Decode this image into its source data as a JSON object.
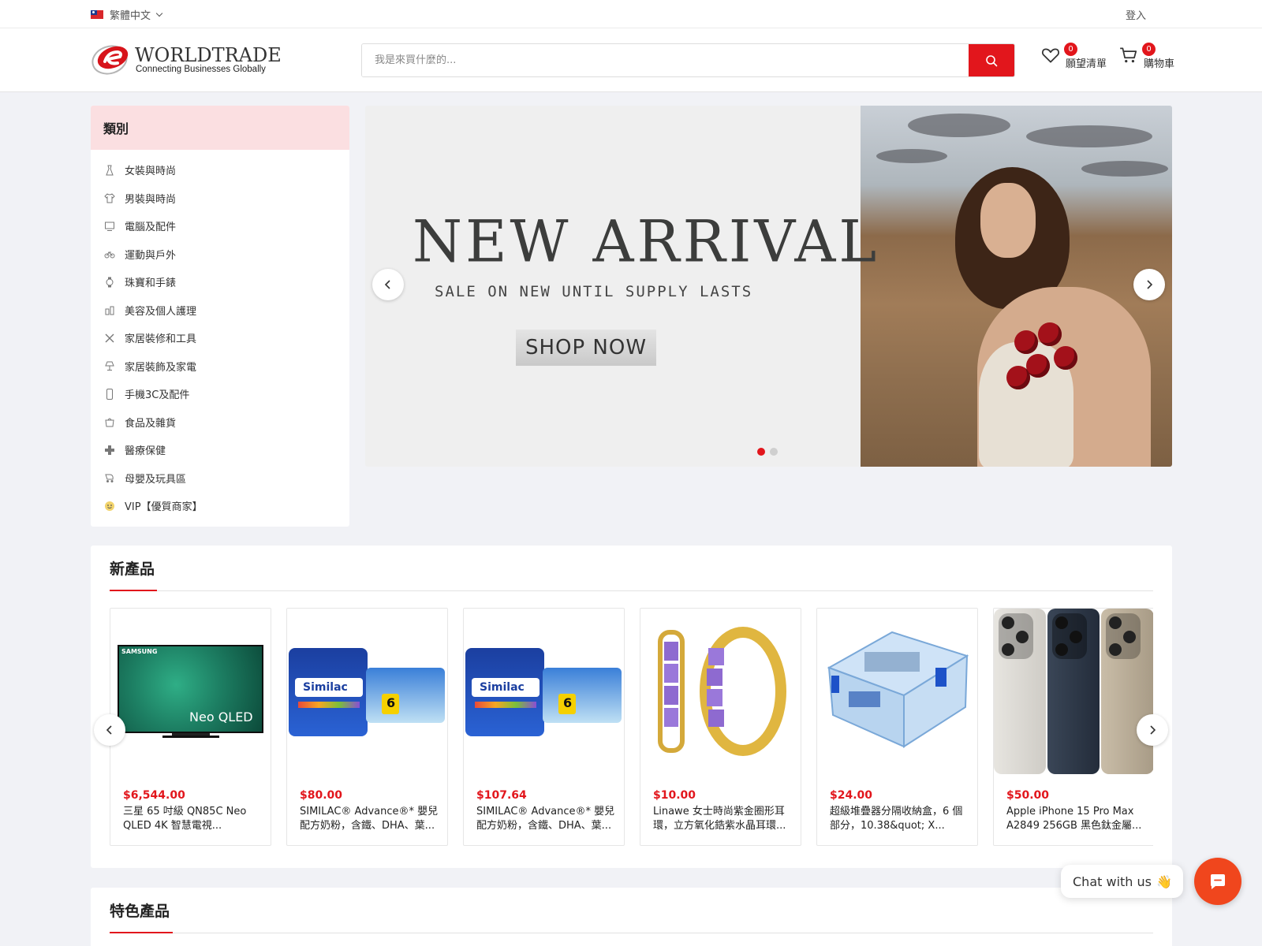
{
  "topbar": {
    "language": "繁體中文",
    "login": "登入"
  },
  "header": {
    "logo_word": "WORLDTRADE",
    "logo_tagline": "Connecting Businesses Globally",
    "search_placeholder": "我是來買什麼的...",
    "wishlist_count": "0",
    "wishlist_label": "願望清單",
    "cart_count": "0",
    "cart_label": "購物車"
  },
  "categories": {
    "title": "類別",
    "items": [
      {
        "label": "女裝與時尚",
        "icon": "dress-icon"
      },
      {
        "label": "男裝與時尚",
        "icon": "shirt-icon"
      },
      {
        "label": "電腦及配件",
        "icon": "computer-icon"
      },
      {
        "label": "運動與戶外",
        "icon": "bike-icon"
      },
      {
        "label": "珠寶和手錶",
        "icon": "watch-icon"
      },
      {
        "label": "美容及個人護理",
        "icon": "beauty-icon"
      },
      {
        "label": "家居裝修和工具",
        "icon": "tools-icon"
      },
      {
        "label": "家居裝飾及家電",
        "icon": "lamp-icon"
      },
      {
        "label": "手機3C及配件",
        "icon": "phone-icon"
      },
      {
        "label": "食品及雜貨",
        "icon": "grocery-icon"
      },
      {
        "label": "醫療保健",
        "icon": "medical-icon"
      },
      {
        "label": "母嬰及玩具區",
        "icon": "stroller-icon"
      },
      {
        "label": "VIP【優質商家】",
        "icon": "vip-icon"
      }
    ]
  },
  "banner": {
    "headline": "NEW ARRIVAL",
    "subline": "SALE ON NEW UNTIL SUPPLY LASTS",
    "cta": "SHOP NOW",
    "slides": 2,
    "active_slide": 1
  },
  "new_products": {
    "title": "新產品",
    "items": [
      {
        "price": "$6,544.00",
        "name": "三星 65 吋級 QN85C Neo QLED 4K 智慧電視...",
        "image": "tv"
      },
      {
        "price": "$80.00",
        "name": "SIMILAC® Advance®* 嬰兒配方奶粉，含鐵、DHA、葉...",
        "image": "formula"
      },
      {
        "price": "$107.64",
        "name": "SIMILAC® Advance®* 嬰兒配方奶粉，含鐵、DHA、葉...",
        "image": "formula"
      },
      {
        "price": "$10.00",
        "name": "Linawe 女士時尚紫金圈形耳環，立方氧化鋯紫水晶耳環...",
        "image": "earrings"
      },
      {
        "price": "$24.00",
        "name": "超級堆疊器分隔收納盒，6 個部分，10.38&quot; X...",
        "image": "box"
      },
      {
        "price": "$50.00",
        "name": "Apple iPhone 15 Pro Max A2849 256GB 黑色鈦金屬...",
        "image": "iphone"
      }
    ],
    "tv_brand": "SAMSUNG",
    "tv_model": "Neo QLED",
    "formula_brand": "Similac",
    "formula_pack": "6"
  },
  "featured_products": {
    "title": "特色產品"
  },
  "chat": {
    "label": "Chat with us",
    "emoji": "👋"
  },
  "colors": {
    "accent": "#e2161c",
    "chat": "#f0461d",
    "category_header": "#fbdfe1"
  }
}
